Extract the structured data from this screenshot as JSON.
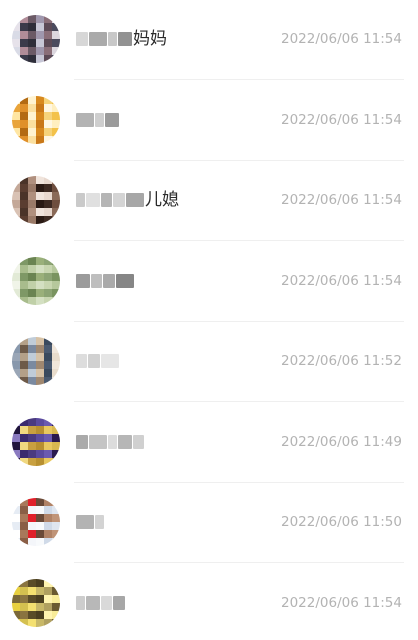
{
  "conversations": [
    {
      "name": "妈妈",
      "time": "2022/06/06 11:54",
      "avatar_colors": [
        "#d9dbe6",
        "#3a3a4a",
        "#6b5a66",
        "#c7c7d6",
        "#8a6e78",
        "#4b4b5e",
        "#e6e2ea",
        "#b08c98",
        "#2e2e3a",
        "#9f97ad",
        "#5c4a56",
        "#dcd7df"
      ],
      "name_blur_colors": [
        "#c9c9c9",
        "#8d8d8d",
        "#b5b5b5",
        "#6e6e6e"
      ]
    },
    {
      "name": "",
      "time": "2022/06/06 11:54",
      "avatar_colors": [
        "#f3c24a",
        "#ffe6a3",
        "#e0902a",
        "#fff3d0",
        "#c97818",
        "#f6d37a",
        "#ffefc0",
        "#e9a43a",
        "#b36a12",
        "#fbe0a0",
        "#d8891e",
        "#fff7e2"
      ],
      "name_blur_colors": [
        "#9a9a9a",
        "#bdbdbd",
        "#7a7a7a"
      ]
    },
    {
      "name": "儿媳",
      "time": "2022/06/06 11:54",
      "avatar_colors": [
        "#3d2a22",
        "#8a6a58",
        "#d9c2b4",
        "#5a3d30",
        "#b0907e",
        "#2a1a14",
        "#e8d8ce",
        "#6e4e3e",
        "#c4a898",
        "#4a3328",
        "#9a7a68",
        "#f0e4dc"
      ],
      "name_blur_colors": [
        "#b8b8b8",
        "#d6d6d6",
        "#9c9c9c",
        "#c6c6c6",
        "#8a8a8a"
      ]
    },
    {
      "name": "",
      "time": "2022/06/06 11:54",
      "avatar_colors": [
        "#9ab07a",
        "#c8d6b0",
        "#7a9460",
        "#e2ead6",
        "#a8bc8c",
        "#6a8452",
        "#d4e0c2",
        "#8ca474",
        "#b6c89c",
        "#f0f4e8",
        "#7e9866",
        "#c0d0a8"
      ],
      "name_blur_colors": [
        "#7a7a7a",
        "#a8a8a8",
        "#8e8e8e",
        "#5e5e5e"
      ]
    },
    {
      "name": "",
      "time": "2022/06/06 11:52",
      "avatar_colors": [
        "#7b8aa0",
        "#d7c2a6",
        "#4a5a70",
        "#e8dccc",
        "#9aa6b6",
        "#6e5a48",
        "#c0ccd8",
        "#a08870",
        "#3a4a5e",
        "#f0e6da",
        "#8898ac",
        "#b4a088"
      ],
      "name_blur_colors": [
        "#d2d2d2",
        "#c2c2c2",
        "#dedede"
      ]
    },
    {
      "name": "",
      "time": "2022/06/06 11:49",
      "avatar_colors": [
        "#3a2a6e",
        "#c8a040",
        "#5a4a9e",
        "#e8c860",
        "#2a1a4e",
        "#8a7ac0",
        "#f0d880",
        "#4a3a80",
        "#b89030",
        "#6a5ab0",
        "#d8b850",
        "#20143c"
      ],
      "name_blur_colors": [
        "#8e8e8e",
        "#b0b0b0",
        "#d0d0d0",
        "#9e9e9e",
        "#c0c0c0"
      ]
    },
    {
      "name": "",
      "time": "2022/06/06 11:50",
      "avatar_colors": [
        "#e6ecf4",
        "#a8785a",
        "#f4f6fa",
        "#6a4a38",
        "#d0dae8",
        "#c09478",
        "#ffffff",
        "#8a5e46",
        "#e0202a",
        "#f8fafc",
        "#b08266",
        "#dfe6f0"
      ],
      "name_blur_colors": [
        "#9a9a9a",
        "#c4c4c4"
      ]
    },
    {
      "name": "",
      "time": "2022/06/06 11:54",
      "avatar_colors": [
        "#6a5a30",
        "#e8d040",
        "#8a7440",
        "#f4e070",
        "#4a3e20",
        "#b0a060",
        "#f8ec98",
        "#7a6838",
        "#d4c050",
        "#5a4c28",
        "#c8b868",
        "#fff4b0"
      ],
      "name_blur_colors": [
        "#bcbcbc",
        "#a0a0a0",
        "#cccccc",
        "#8a8a8a"
      ]
    }
  ]
}
